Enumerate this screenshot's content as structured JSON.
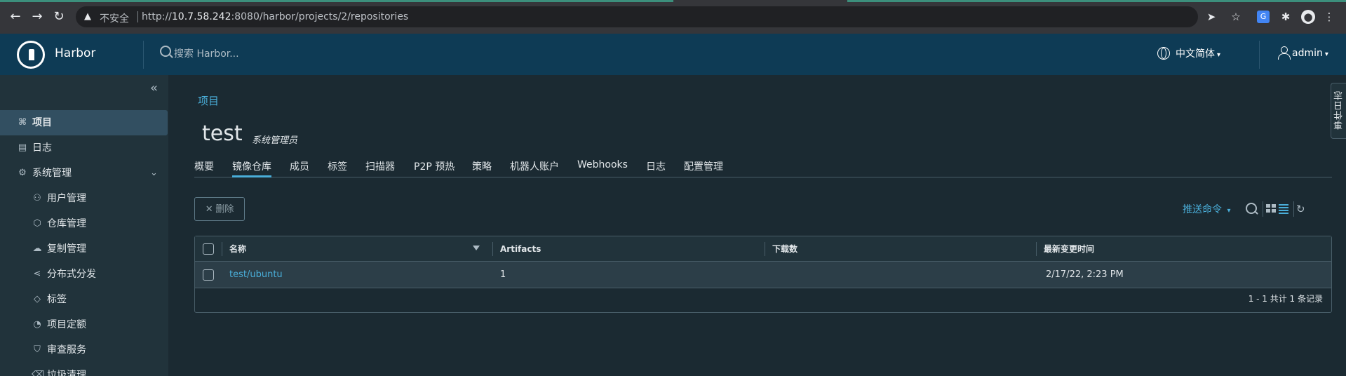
{
  "browser": {
    "insecure_label": "不安全",
    "url_prefix": "http://",
    "url_host": "10.7.58.242",
    "url_rest": ":8080/harbor/projects/2/repositories"
  },
  "header": {
    "brand": "Harbor",
    "search_placeholder": "搜索 Harbor...",
    "language": "中文简体",
    "user": "admin"
  },
  "sidebar": {
    "items": [
      {
        "label": "项目",
        "icon": "projects-icon"
      },
      {
        "label": "日志",
        "icon": "logs-icon"
      },
      {
        "label": "系统管理",
        "icon": "admin-icon"
      },
      {
        "label": "用户管理",
        "icon": "users-icon"
      },
      {
        "label": "仓库管理",
        "icon": "registries-icon"
      },
      {
        "label": "复制管理",
        "icon": "replication-icon"
      },
      {
        "label": "分布式分发",
        "icon": "distribution-icon"
      },
      {
        "label": "标签",
        "icon": "tag-icon"
      },
      {
        "label": "项目定额",
        "icon": "quota-icon"
      },
      {
        "label": "审查服务",
        "icon": "shield-icon"
      },
      {
        "label": "垃圾清理",
        "icon": "trash-icon"
      }
    ]
  },
  "main": {
    "breadcrumb": "项目",
    "project_name": "test",
    "role": "系统管理员",
    "tabs": [
      "概要",
      "镜像仓库",
      "成员",
      "标签",
      "扫描器",
      "P2P 预热",
      "策略",
      "机器人账户",
      "Webhooks",
      "日志",
      "配置管理"
    ],
    "active_tab": "镜像仓库",
    "delete_label": "删除",
    "push_label": "推送命令",
    "table": {
      "columns": [
        "名称",
        "Artifacts",
        "下载数",
        "最新变更时间"
      ],
      "rows": [
        {
          "name": "test/ubuntu",
          "artifacts": "1",
          "pulls": "",
          "updated": "2/17/22, 2:23 PM"
        }
      ],
      "footer": "1 - 1 共计 1 条记录"
    },
    "event_tab": "事件日志"
  },
  "colors": {
    "accent": "#4aaed9",
    "header_bg": "#0e3b55",
    "sidebar_bg": "#21333b",
    "page_bg": "#1b2a32"
  }
}
